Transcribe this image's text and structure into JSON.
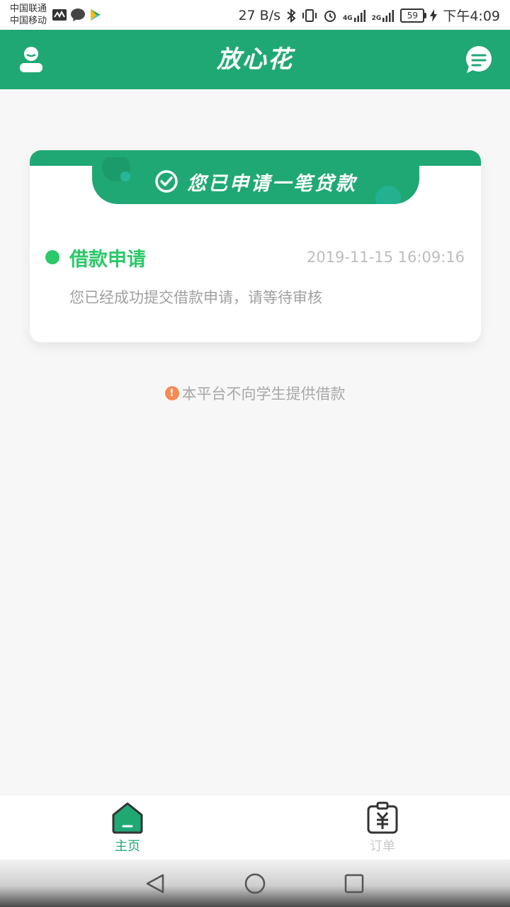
{
  "status_bar": {
    "carrier_1": "中国联通",
    "carrier_2": "中国移动",
    "net_speed": "27 B/s",
    "net_4g": "4G",
    "net_2g": "2G",
    "battery": "59",
    "time": "下午4:09"
  },
  "header": {
    "title": "放心花",
    "color": "#20a874",
    "left_icon": "profile-icon",
    "right_icon": "message-icon"
  },
  "card": {
    "ribbon_text": "您已申请一笔贷款",
    "ribbon_icon": "check-circle-icon",
    "step_title": "借款申请",
    "step_time": "2019-11-15 16:09:16",
    "step_desc": "您已经成功提交借款申请，请等待审核",
    "step_color": "#2cc86a"
  },
  "notice": {
    "icon": "warning-icon",
    "text": "本平台不向学生提供借款",
    "icon_color": "#f58a55"
  },
  "bottom_nav": {
    "items": [
      {
        "label": "主页",
        "icon": "home-icon",
        "active": true
      },
      {
        "label": "订单",
        "icon": "order-icon",
        "active": false
      }
    ],
    "active_color": "#20a874",
    "inactive_color": "#c8c8c8"
  },
  "system_nav": {
    "buttons": [
      "back-icon",
      "home-circle-icon",
      "recent-apps-icon"
    ]
  }
}
